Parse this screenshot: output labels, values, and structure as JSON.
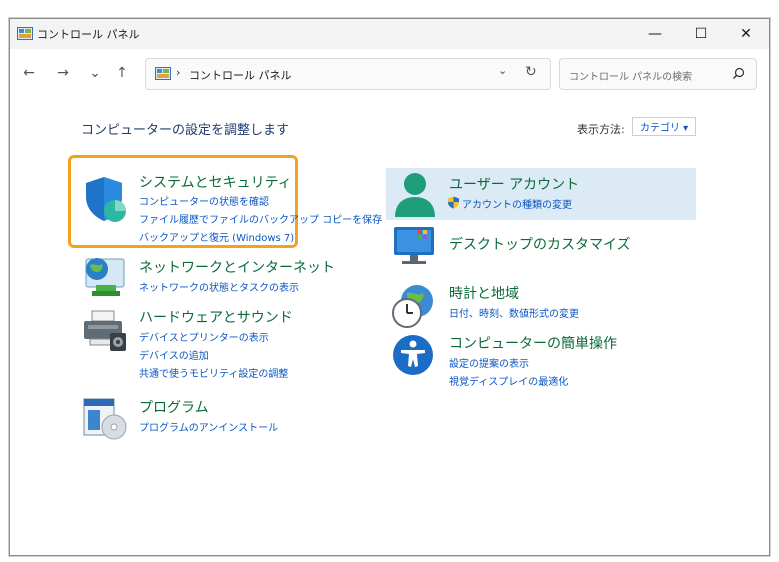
{
  "window": {
    "title": "コントロール パネル"
  },
  "controls": {
    "minimize": "—",
    "maximize": "☐",
    "close": "✕"
  },
  "nav": {
    "back": "←",
    "forward": "→",
    "recent": "⌄",
    "up": "↑",
    "address": "コントロール パネル",
    "breadcrumb_sep": "›",
    "dropdown": "⌄",
    "refresh": "↻",
    "search_placeholder": "コントロール パネルの検索"
  },
  "header": {
    "title": "コンピューターの設定を調整します",
    "view_by_label": "表示方法:",
    "view_by_value": "カテゴリ ▾"
  },
  "categories": [
    {
      "title": "システムとセキュリティ",
      "links": [
        "コンピューターの状態を確認",
        "ファイル履歴でファイルのバックアップ コピーを保存",
        "バックアップと復元 (Windows 7)"
      ],
      "icon": "shield-icon"
    },
    {
      "title": "ネットワークとインターネット",
      "links": [
        "ネットワークの状態とタスクの表示"
      ],
      "icon": "network-globe-icon"
    },
    {
      "title": "ハードウェアとサウンド",
      "links": [
        "デバイスとプリンターの表示",
        "デバイスの追加",
        "共通で使うモビリティ設定の調整"
      ],
      "icon": "printer-icon"
    },
    {
      "title": "プログラム",
      "links": [
        "プログラムのアンインストール"
      ],
      "icon": "programs-disc-icon"
    },
    {
      "title": "ユーザー アカウント",
      "links": [
        "アカウントの種類の変更"
      ],
      "icon": "user-account-icon"
    },
    {
      "title": "デスクトップのカスタマイズ",
      "links": [],
      "icon": "desktop-monitor-icon"
    },
    {
      "title": "時計と地域",
      "links": [
        "日付、時刻、数値形式の変更"
      ],
      "icon": "clock-globe-icon"
    },
    {
      "title": "コンピューターの簡単操作",
      "links": [
        "設定の提案の表示",
        "視覚ディスプレイの最適化"
      ],
      "icon": "accessibility-icon"
    }
  ],
  "colors": {
    "highlight": "#f4a21b",
    "link": "#0a56c4",
    "category_title": "#0b6a3a",
    "selected_bg": "#dceaf6"
  }
}
